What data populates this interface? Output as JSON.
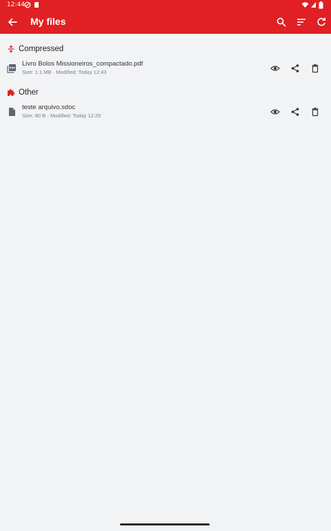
{
  "status_bar": {
    "time": "12:44"
  },
  "app_bar": {
    "title": "My files",
    "color": "#e02024"
  },
  "sections": [
    {
      "title": "Compressed",
      "icon": "compress-icon",
      "files": [
        {
          "name": "Livro Bolos Missioneiros_compactado.pdf",
          "meta": "Size: 1.1 MB · Modified: Today 12:43",
          "icon": "pdf-icon"
        }
      ]
    },
    {
      "title": "Other",
      "icon": "puzzle-icon",
      "files": [
        {
          "name": "teste arquivo.sdoc",
          "meta": "Size: 80 B · Modified: Today 12:29",
          "icon": "document-icon"
        }
      ]
    }
  ]
}
